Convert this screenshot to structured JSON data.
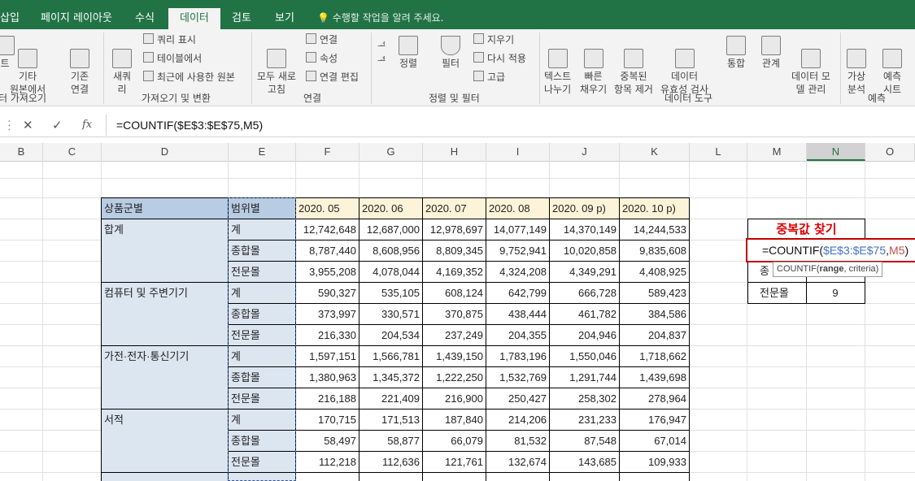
{
  "tabs": [
    {
      "label": "삽입"
    },
    {
      "label": "페이지 레이아웃"
    },
    {
      "label": "수식"
    },
    {
      "label": "데이터"
    },
    {
      "label": "검토"
    },
    {
      "label": "보기"
    }
  ],
  "tell_me": "수행할 작업을 알려 주세요.",
  "ribbon": {
    "groups": {
      "get_external": "터 가져오기",
      "get_transform": "가져오기 및 변환",
      "connections": "연결",
      "sort_filter": "정렬 및 필터",
      "data_tools": "데이터 도구",
      "forecast": "예측"
    },
    "buttons": {
      "other_sources": "기타\n원본에서",
      "existing_conn": "기존\n연결",
      "new_query": "새쿼\n리",
      "show_queries": "쿼리 표시",
      "from_table": "테이블에서",
      "recent_sources": "최근에 사용한 원본",
      "refresh_all": "모두 새로\n고침",
      "connections": "연결",
      "properties": "속성",
      "edit_links": "연결 편집",
      "sort": "정렬",
      "filter": "필터",
      "clear": "지우기",
      "reapply": "다시 적용",
      "advanced": "고급",
      "text_to_cols": "텍스트\n나누기",
      "flash_fill": "빠른\n채우기",
      "remove_dup": "중복된\n항목 제거",
      "validation": "데이터\n유효성 검사",
      "consolidate": "통합",
      "relationships": "관계",
      "data_model": "데이터 모\n델 관리",
      "whatif": "가상\n분석",
      "forecast_sheet": "예측\n시트"
    }
  },
  "formula_bar": {
    "cancel": "✕",
    "enter": "✓",
    "fx": "fx",
    "formula": "=COUNTIF($E$3:$E$75,M5)"
  },
  "columns": [
    "B",
    "C",
    "D",
    "E",
    "F",
    "G",
    "H",
    "I",
    "J",
    "K",
    "L",
    "M",
    "N",
    "O"
  ],
  "table": {
    "header_d": "상품군별",
    "header_e": "범위별",
    "dates": [
      "2020. 05",
      "2020. 06",
      "2020. 07",
      "2020. 08",
      "2020. 09 p)",
      "2020. 10 p)"
    ],
    "groups": [
      {
        "name": "합계",
        "rows": [
          {
            "label": "계",
            "values": [
              "12,742,648",
              "12,687,000",
              "12,978,697",
              "14,077,149",
              "14,370,149",
              "14,244,533"
            ]
          },
          {
            "label": "종합몰",
            "values": [
              "8,787,440",
              "8,608,956",
              "8,809,345",
              "9,752,941",
              "10,020,858",
              "9,835,608"
            ]
          },
          {
            "label": "전문몰",
            "values": [
              "3,955,208",
              "4,078,044",
              "4,169,352",
              "4,324,208",
              "4,349,291",
              "4,408,925"
            ]
          }
        ]
      },
      {
        "name": "컴퓨터 및 주변기기",
        "rows": [
          {
            "label": "계",
            "values": [
              "590,327",
              "535,105",
              "608,124",
              "642,799",
              "666,728",
              "589,423"
            ]
          },
          {
            "label": "종합몰",
            "values": [
              "373,997",
              "330,571",
              "370,875",
              "438,444",
              "461,782",
              "384,586"
            ]
          },
          {
            "label": "전문몰",
            "values": [
              "216,330",
              "204,534",
              "237,249",
              "204,355",
              "204,946",
              "204,837"
            ]
          }
        ]
      },
      {
        "name": "가전·전자·통신기기",
        "rows": [
          {
            "label": "계",
            "values": [
              "1,597,151",
              "1,566,781",
              "1,439,150",
              "1,783,196",
              "1,550,046",
              "1,718,662"
            ]
          },
          {
            "label": "종합몰",
            "values": [
              "1,380,963",
              "1,345,372",
              "1,222,250",
              "1,532,769",
              "1,291,744",
              "1,439,698"
            ]
          },
          {
            "label": "전문몰",
            "values": [
              "216,188",
              "221,409",
              "216,900",
              "250,427",
              "258,302",
              "278,964"
            ]
          }
        ]
      },
      {
        "name": "서적",
        "rows": [
          {
            "label": "계",
            "values": [
              "170,715",
              "171,513",
              "187,840",
              "214,206",
              "231,233",
              "176,947"
            ]
          },
          {
            "label": "종합몰",
            "values": [
              "58,497",
              "58,877",
              "66,079",
              "81,532",
              "87,548",
              "67,014"
            ]
          },
          {
            "label": "전문몰",
            "values": [
              "112,218",
              "112,636",
              "121,761",
              "132,674",
              "143,685",
              "109,933"
            ]
          }
        ]
      }
    ]
  },
  "lookup": {
    "title": "중복값 찾기",
    "editing_formula_prefix": "=COUNTIF(",
    "editing_formula_range": "$E$3:$E$75",
    "editing_formula_comma": ",",
    "editing_formula_ref": "M5",
    "editing_formula_close": ")",
    "row2_label": "종",
    "row3_label": "전문몰",
    "row3_value": "9"
  },
  "tooltip": {
    "fn": "COUNTIF(",
    "arg1": "range",
    "sep": ", criteria)"
  },
  "colors": {
    "ribbon_green": "#217346",
    "range_blue": "#4472c4",
    "ref_red": "#c0504d",
    "title_red": "#e00000"
  }
}
